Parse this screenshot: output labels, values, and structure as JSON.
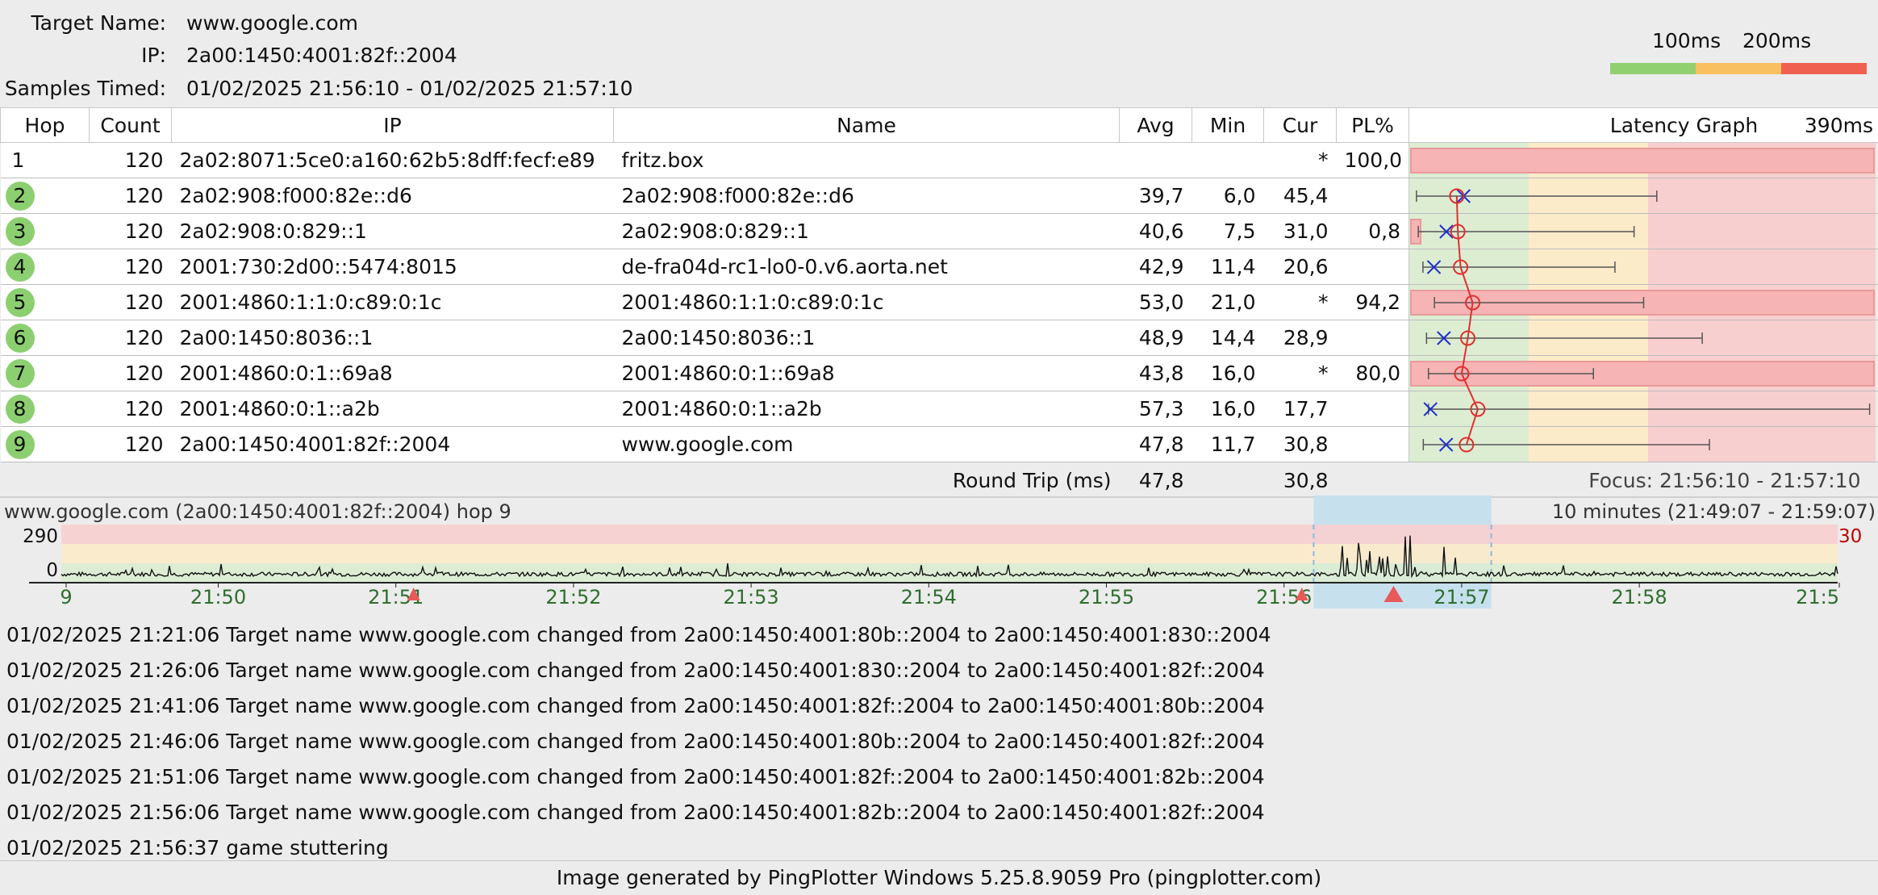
{
  "target": {
    "name_label": "Target Name:",
    "name": "www.google.com",
    "ip_label": "IP:",
    "ip": "2a00:1450:4001:82f::2004",
    "samples_label": "Samples Timed:",
    "samples": "01/02/2025 21:56:10 - 01/02/2025 21:57:10"
  },
  "scale_legend": {
    "label_100": "100ms",
    "label_200": "200ms",
    "colors": [
      "#90d070",
      "#f8c060",
      "#f06050"
    ]
  },
  "table": {
    "headers": [
      "Hop",
      "Count",
      "IP",
      "Name",
      "Avg",
      "Min",
      "Cur",
      "PL%",
      "Latency Graph",
      "390ms"
    ],
    "rows": [
      {
        "hop": "1",
        "count": "120",
        "ip": "2a02:8071:5ce0:a160:62b5:8dff:fecf:e89",
        "name": "fritz.box",
        "avg": "",
        "min": "",
        "cur": "*",
        "pl": "100,0",
        "green": false,
        "lat_min": null,
        "lat_avg": null,
        "lat_cur": null,
        "lat_max": null,
        "pl_fraction": 1.0
      },
      {
        "hop": "2",
        "count": "120",
        "ip": "2a02:908:f000:82e::d6",
        "name": "2a02:908:f000:82e::d6",
        "avg": "39,7",
        "min": "6,0",
        "cur": "45,4",
        "pl": "",
        "green": true,
        "lat_min": 6.0,
        "lat_avg": 39.7,
        "lat_cur": 45.4,
        "lat_max": 207,
        "pl_fraction": 0
      },
      {
        "hop": "3",
        "count": "120",
        "ip": "2a02:908:0:829::1",
        "name": "2a02:908:0:829::1",
        "avg": "40,6",
        "min": "7,5",
        "cur": "31,0",
        "pl": "0,8",
        "green": true,
        "lat_min": 7.5,
        "lat_avg": 40.6,
        "lat_cur": 31.0,
        "lat_max": 188,
        "pl_fraction": 0.008
      },
      {
        "hop": "4",
        "count": "120",
        "ip": "2001:730:2d00::5474:8015",
        "name": "de-fra04d-rc1-lo0-0.v6.aorta.net",
        "avg": "42,9",
        "min": "11,4",
        "cur": "20,6",
        "pl": "",
        "green": true,
        "lat_min": 11.4,
        "lat_avg": 42.9,
        "lat_cur": 20.6,
        "lat_max": 172,
        "pl_fraction": 0
      },
      {
        "hop": "5",
        "count": "120",
        "ip": "2001:4860:1:1:0:c89:0:1c",
        "name": "2001:4860:1:1:0:c89:0:1c",
        "avg": "53,0",
        "min": "21,0",
        "cur": "*",
        "pl": "94,2",
        "green": true,
        "lat_min": 21.0,
        "lat_avg": 53.0,
        "lat_cur": null,
        "lat_max": 196,
        "pl_fraction": 0.942
      },
      {
        "hop": "6",
        "count": "120",
        "ip": "2a00:1450:8036::1",
        "name": "2a00:1450:8036::1",
        "avg": "48,9",
        "min": "14,4",
        "cur": "28,9",
        "pl": "",
        "green": true,
        "lat_min": 14.4,
        "lat_avg": 48.9,
        "lat_cur": 28.9,
        "lat_max": 245,
        "pl_fraction": 0
      },
      {
        "hop": "7",
        "count": "120",
        "ip": "2001:4860:0:1::69a8",
        "name": "2001:4860:0:1::69a8",
        "avg": "43,8",
        "min": "16,0",
        "cur": "*",
        "pl": "80,0",
        "green": true,
        "lat_min": 16.0,
        "lat_avg": 43.8,
        "lat_cur": null,
        "lat_max": 154,
        "pl_fraction": 0.8
      },
      {
        "hop": "8",
        "count": "120",
        "ip": "2001:4860:0:1::a2b",
        "name": "2001:4860:0:1::a2b",
        "avg": "57,3",
        "min": "16,0",
        "cur": "17,7",
        "pl": "",
        "green": true,
        "lat_min": 16.0,
        "lat_avg": 57.3,
        "lat_cur": 17.7,
        "lat_max": 385,
        "pl_fraction": 0
      },
      {
        "hop": "9",
        "count": "120",
        "ip": "2a00:1450:4001:82f::2004",
        "name": "www.google.com",
        "avg": "47,8",
        "min": "11,7",
        "cur": "30,8",
        "pl": "",
        "green": true,
        "lat_min": 11.7,
        "lat_avg": 47.8,
        "lat_cur": 30.8,
        "lat_max": 251,
        "pl_fraction": 0
      }
    ],
    "summary": {
      "label": "Round Trip (ms)",
      "avg": "47,8",
      "cur": "30,8",
      "focus": "Focus: 21:56:10 - 21:57:10"
    }
  },
  "latency_graph": {
    "max_ms": 390,
    "zones": [
      {
        "from": 0,
        "to": 100,
        "color": "#dcedd2"
      },
      {
        "from": 100,
        "to": 200,
        "color": "#fcebc9"
      },
      {
        "from": 200,
        "to": 390,
        "color": "#f8cfcf"
      }
    ]
  },
  "timeline": {
    "title": "www.google.com (2a00:1450:4001:82f::2004) hop 9",
    "range": "10 minutes (21:49:07 - 21:59:07)",
    "y_top_label": "290",
    "y_bottom_label": "0",
    "right_marker": "30",
    "x_ticks": [
      "9",
      "21:50",
      "21:51",
      "21:52",
      "21:53",
      "21:54",
      "21:55",
      "21:56",
      "21:57",
      "21:58",
      "21:5"
    ],
    "focus_start": "21:56:10",
    "focus_end": "21:57:10",
    "event_markers": [
      "21:51:06",
      "21:56:06",
      "21:56:37"
    ]
  },
  "events": [
    "01/02/2025 21:21:06 Target name www.google.com changed from 2a00:1450:4001:80b::2004 to 2a00:1450:4001:830::2004",
    "01/02/2025 21:26:06 Target name www.google.com changed from 2a00:1450:4001:830::2004 to 2a00:1450:4001:82f::2004",
    "01/02/2025 21:41:06 Target name www.google.com changed from 2a00:1450:4001:82f::2004 to 2a00:1450:4001:80b::2004",
    "01/02/2025 21:46:06 Target name www.google.com changed from 2a00:1450:4001:80b::2004 to 2a00:1450:4001:82f::2004",
    "01/02/2025 21:51:06 Target name www.google.com changed from 2a00:1450:4001:82f::2004 to 2a00:1450:4001:82b::2004",
    "01/02/2025 21:56:06 Target name www.google.com changed from 2a00:1450:4001:82b::2004 to 2a00:1450:4001:82f::2004",
    "01/02/2025 21:56:37 game stuttering"
  ],
  "footer": "Image generated by PingPlotter Windows 5.25.8.9059 Pro (pingplotter.com)"
}
